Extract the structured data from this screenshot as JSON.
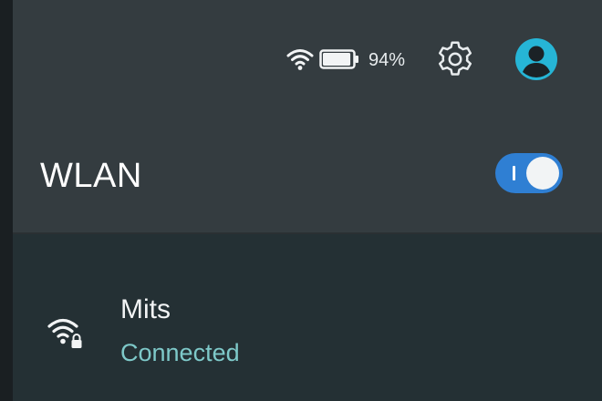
{
  "status_bar": {
    "battery_percent_text": "94%",
    "battery_level": 0.94,
    "icons": {
      "wifi": "wifi-icon",
      "battery": "battery-icon",
      "settings": "gear-icon",
      "account": "account-circle-icon"
    }
  },
  "wlan": {
    "title": "WLAN",
    "toggle_on": true
  },
  "networks": [
    {
      "name": "Mits",
      "status": "Connected",
      "secured": true
    }
  ],
  "colors": {
    "header_background": "#343c40",
    "list_background": "#243034",
    "toggle_accent": "#2f7fd3",
    "avatar_accent": "#26b5d6",
    "connected_text": "#7ec9c9"
  }
}
